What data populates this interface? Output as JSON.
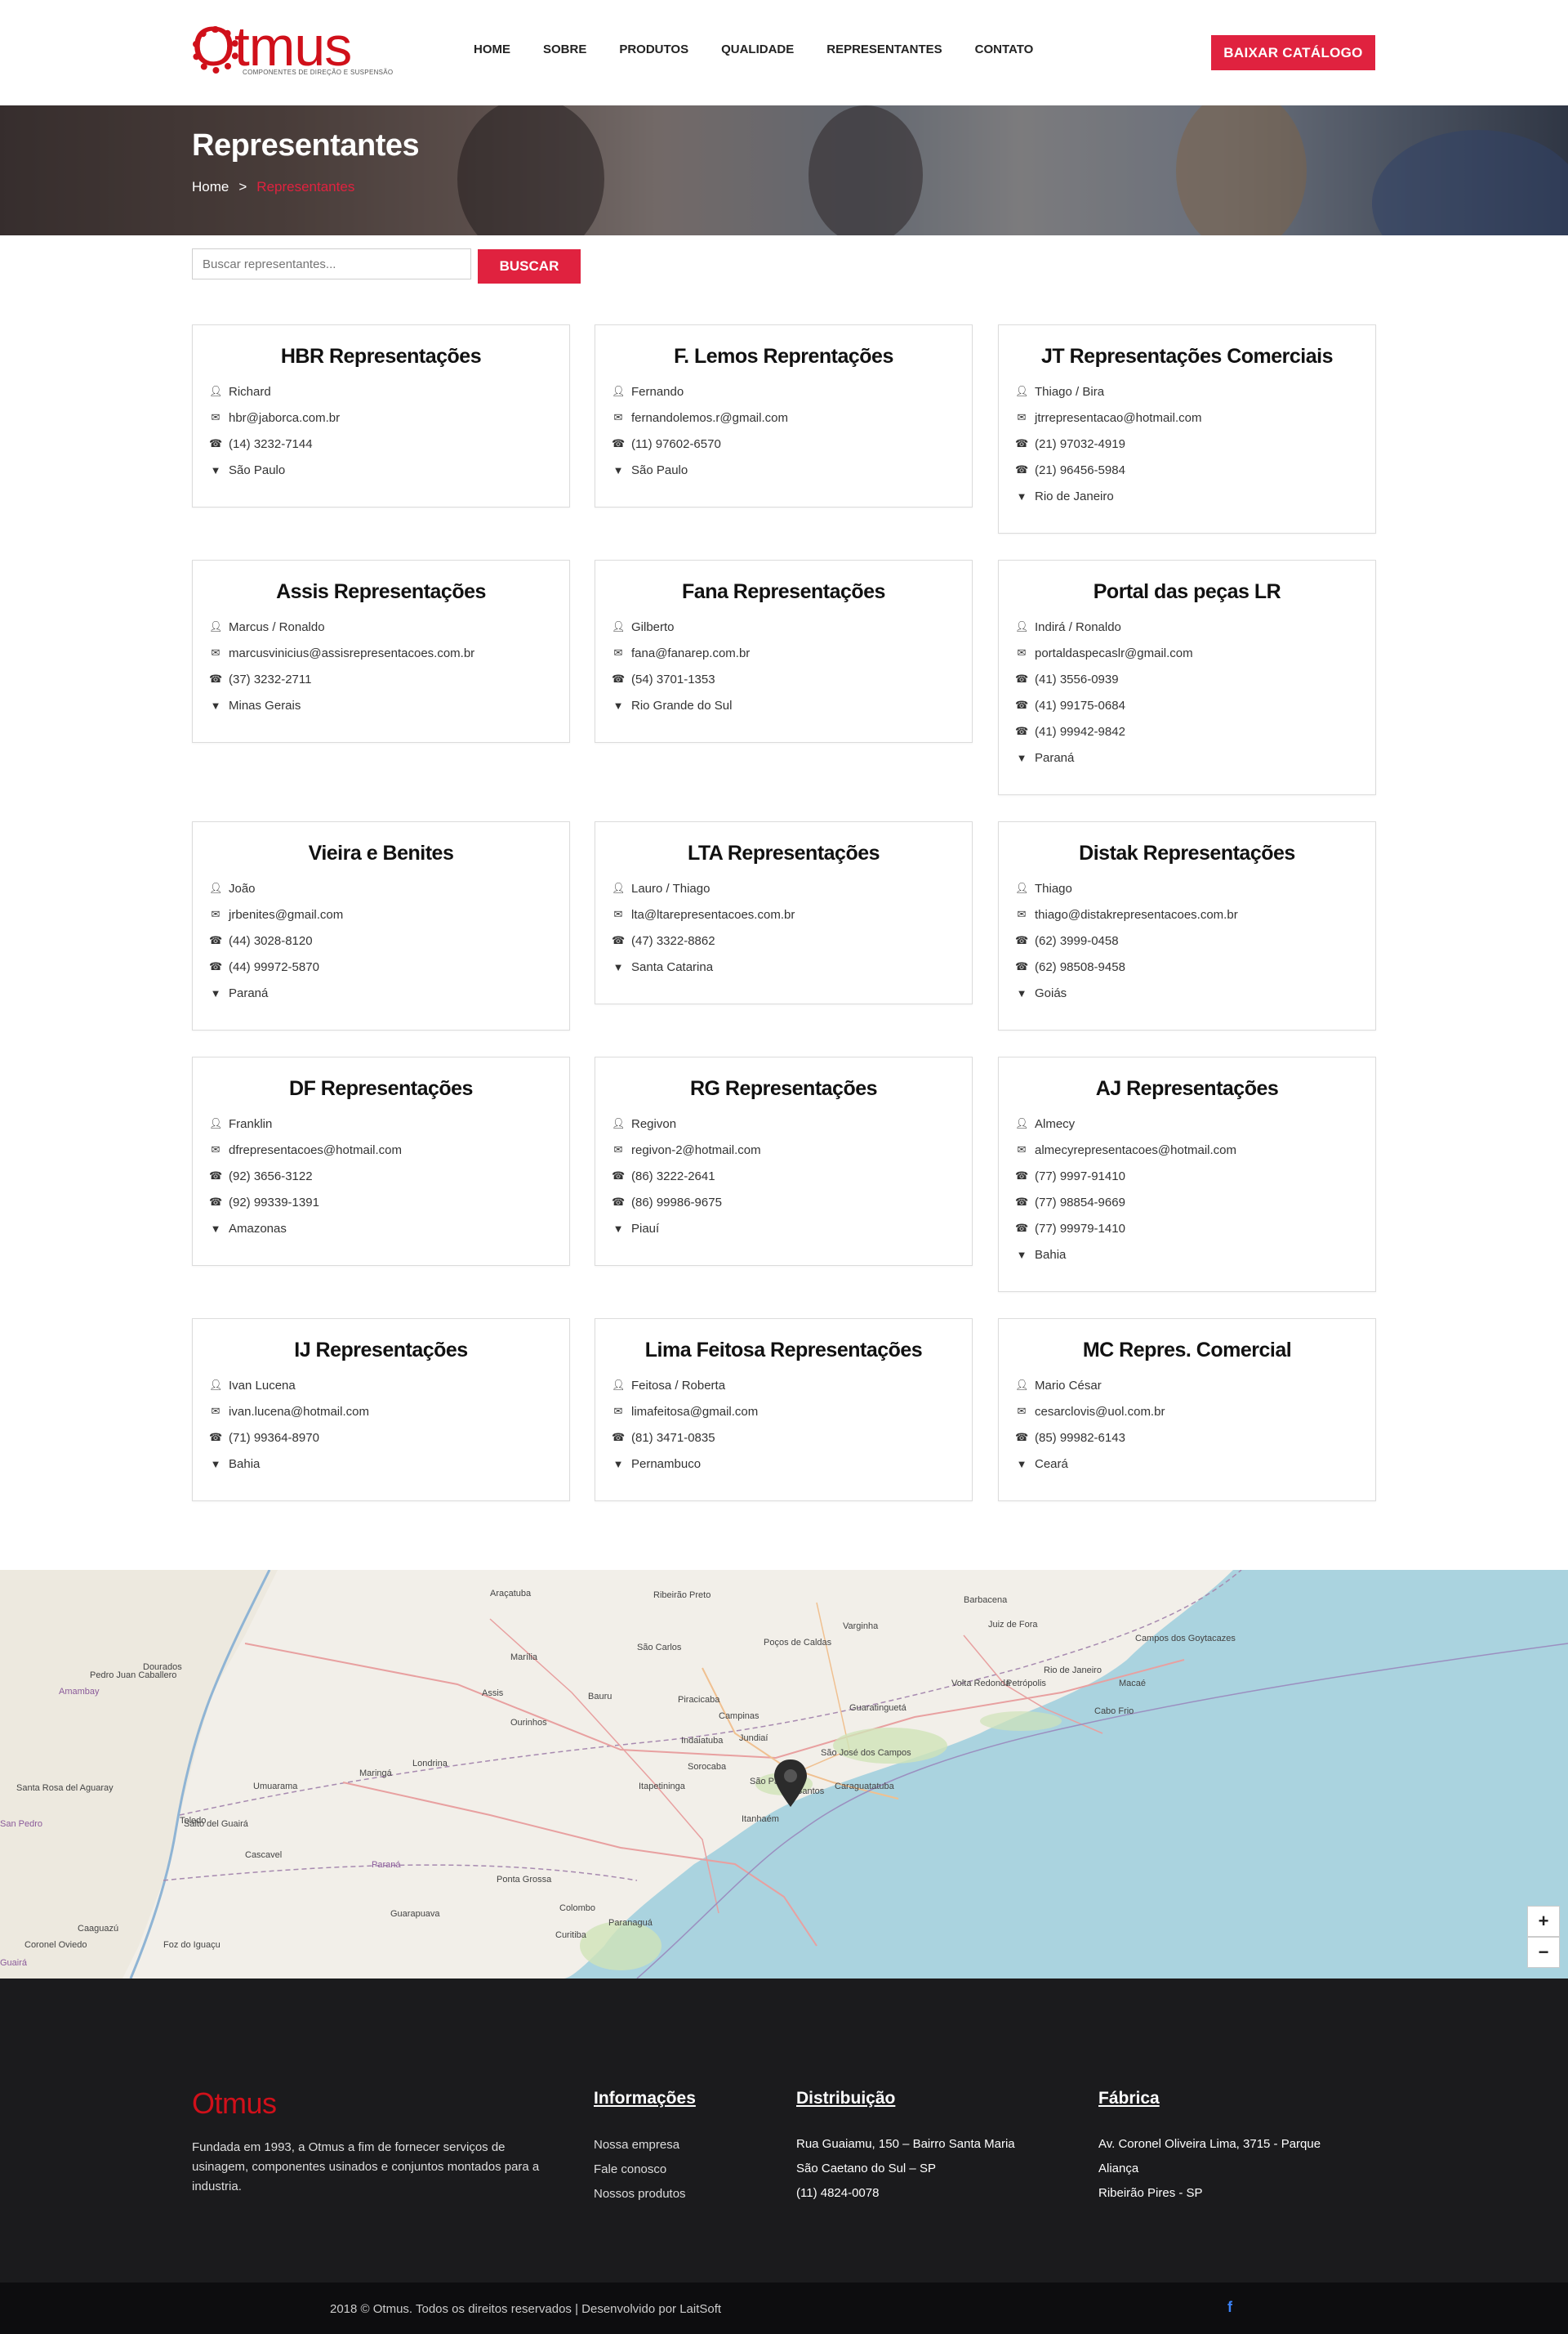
{
  "header": {
    "logo_text": "Otmus",
    "logo_tagline": "COMPONENTES DE DIREÇÃO E SUSPENSÃO",
    "nav": [
      "HOME",
      "SOBRE",
      "PRODUTOS",
      "QUALIDADE",
      "REPRESENTANTES",
      "CONTATO"
    ],
    "catalog_button": "BAIXAR CATÁLOGO"
  },
  "hero": {
    "title": "Representantes",
    "breadcrumb_home": "Home",
    "breadcrumb_sep": ">",
    "breadcrumb_current": "Representantes"
  },
  "search": {
    "placeholder": "Buscar representantes...",
    "button": "BUSCAR"
  },
  "representatives": [
    {
      "name": "HBR Representações",
      "contact": "Richard",
      "email": "hbr@jaborca.com.br",
      "phones": [
        "(14) 3232-7144"
      ],
      "region": "São Paulo"
    },
    {
      "name": "F. Lemos Reprentações",
      "contact": "Fernando",
      "email": "fernandolemos.r@gmail.com",
      "phones": [
        "(11) 97602-6570"
      ],
      "region": "São Paulo"
    },
    {
      "name": "JT Representações Comerciais",
      "contact": "Thiago / Bira",
      "email": "jtrrepresentacao@hotmail.com",
      "phones": [
        "(21) 97032-4919",
        "(21) 96456-5984"
      ],
      "region": "Rio de Janeiro"
    },
    {
      "name": "Assis Representações",
      "contact": "Marcus / Ronaldo",
      "email": "marcusvinicius@assisrepresentacoes.com.br",
      "phones": [
        "(37) 3232-2711"
      ],
      "region": "Minas Gerais"
    },
    {
      "name": "Fana Representações",
      "contact": "Gilberto",
      "email": "fana@fanarep.com.br",
      "phones": [
        "(54) 3701-1353"
      ],
      "region": "Rio Grande do Sul"
    },
    {
      "name": "Portal das peças LR",
      "contact": "Indirá / Ronaldo",
      "email": "portaldaspecaslr@gmail.com",
      "phones": [
        "(41) 3556-0939",
        "(41) 99175-0684",
        "(41) 99942-9842"
      ],
      "region": "Paraná"
    },
    {
      "name": "Vieira e Benites",
      "contact": "João",
      "email": "jrbenites@gmail.com",
      "phones": [
        "(44) 3028-8120",
        "(44) 99972-5870"
      ],
      "region": "Paraná"
    },
    {
      "name": "LTA Representações",
      "contact": "Lauro / Thiago",
      "email": "lta@ltarepresentacoes.com.br",
      "phones": [
        "(47) 3322-8862"
      ],
      "region": "Santa Catarina"
    },
    {
      "name": "Distak Representações",
      "contact": "Thiago",
      "email": "thiago@distakrepresentacoes.com.br",
      "phones": [
        "(62) 3999-0458",
        "(62) 98508-9458"
      ],
      "region": "Goiás"
    },
    {
      "name": "DF Representações",
      "contact": "Franklin",
      "email": "dfrepresentacoes@hotmail.com",
      "phones": [
        "(92) 3656-3122",
        "(92) 99339-1391"
      ],
      "region": "Amazonas"
    },
    {
      "name": "RG Representações",
      "contact": "Regivon",
      "email": "regivon-2@hotmail.com",
      "phones": [
        "(86) 3222-2641",
        "(86) 99986-9675"
      ],
      "region": "Piauí"
    },
    {
      "name": "AJ Representações",
      "contact": "Almecy",
      "email": "almecyrepresentacoes@hotmail.com",
      "phones": [
        "(77) 9997-91410",
        "(77) 98854-9669",
        "(77) 99979-1410"
      ],
      "region": "Bahia"
    },
    {
      "name": "IJ Representações",
      "contact": "Ivan Lucena",
      "email": "ivan.lucena@hotmail.com",
      "phones": [
        "(71) 99364-8970"
      ],
      "region": "Bahia"
    },
    {
      "name": "Lima Feitosa Representações",
      "contact": "Feitosa / Roberta",
      "email": "limafeitosa@gmail.com",
      "phones": [
        "(81) 3471-0835"
      ],
      "region": "Pernambuco"
    },
    {
      "name": "MC Repres. Comercial",
      "contact": "Mario César",
      "email": "cesarclovis@uol.com.br",
      "phones": [
        "(85) 99982-6143"
      ],
      "region": "Ceará"
    }
  ],
  "map": {
    "labels": [
      "Araçatuba",
      "Ribeirão Preto",
      "Barbacena",
      "Juiz de Fora",
      "Campos dos Goytacazes",
      "Dourados",
      "Marília",
      "São Carlos",
      "Poços de Caldas",
      "Varginha",
      "Volta Redonda",
      "Petrópolis",
      "Rio de Janeiro",
      "Macaé",
      "Cabo Frio",
      "Assis",
      "Bauru",
      "Piracicaba",
      "Campinas",
      "Jundiaí",
      "Guaratinguetá",
      "Ourinhos",
      "Indaiatuba",
      "São José dos Campos",
      "Maringá",
      "Londrina",
      "Sorocaba",
      "São Paulo",
      "Santos",
      "Caraguatatuba",
      "Umuarama",
      "Itapetininga",
      "Itanhaém",
      "Toledo",
      "Cascavel",
      "Ponta Grossa",
      "Colombo",
      "Curitiba",
      "Paranaguá",
      "Guarapuava",
      "Paraná",
      "Santa Rosa del Aguaray",
      "Salto del Guairá",
      "Pedro Juan Caballero",
      "San Pedro",
      "Caaguazú",
      "Coronel Oviedo",
      "Foz do Iguaçu",
      "Amambay",
      "Guairá"
    ],
    "zoom_in": "+",
    "zoom_out": "−"
  },
  "footer": {
    "logo_text": "Otmus",
    "about": "Fundada em 1993, a Otmus a fim de fornecer serviços de usinagem, componentes usinados e conjuntos montados para a industria.",
    "info_heading": "Informações",
    "info_links": [
      "Nossa empresa",
      "Fale conosco",
      "Nossos produtos"
    ],
    "dist_heading": "Distribuição",
    "dist_lines": [
      "Rua Guaiamu, 150 – Bairro Santa Maria",
      "São Caetano do Sul – SP",
      "(11) 4824-0078"
    ],
    "factory_heading": "Fábrica",
    "factory_lines": [
      "Av. Coronel Oliveira Lima, 3715 - Parque",
      "Aliança",
      "Ribeirão Pires - SP"
    ],
    "copyright": "2018 © Otmus. Todos os direitos reservados | Desenvolvido por LaitSoft",
    "facebook_glyph": "f"
  },
  "colors": {
    "accent": "#e0223f",
    "logo_red": "#d0101a",
    "footer_bg": "#1b1b1d",
    "bottom_bar_bg": "#0d0d0f",
    "water": "#aad3df",
    "land": "#f2efe9"
  }
}
